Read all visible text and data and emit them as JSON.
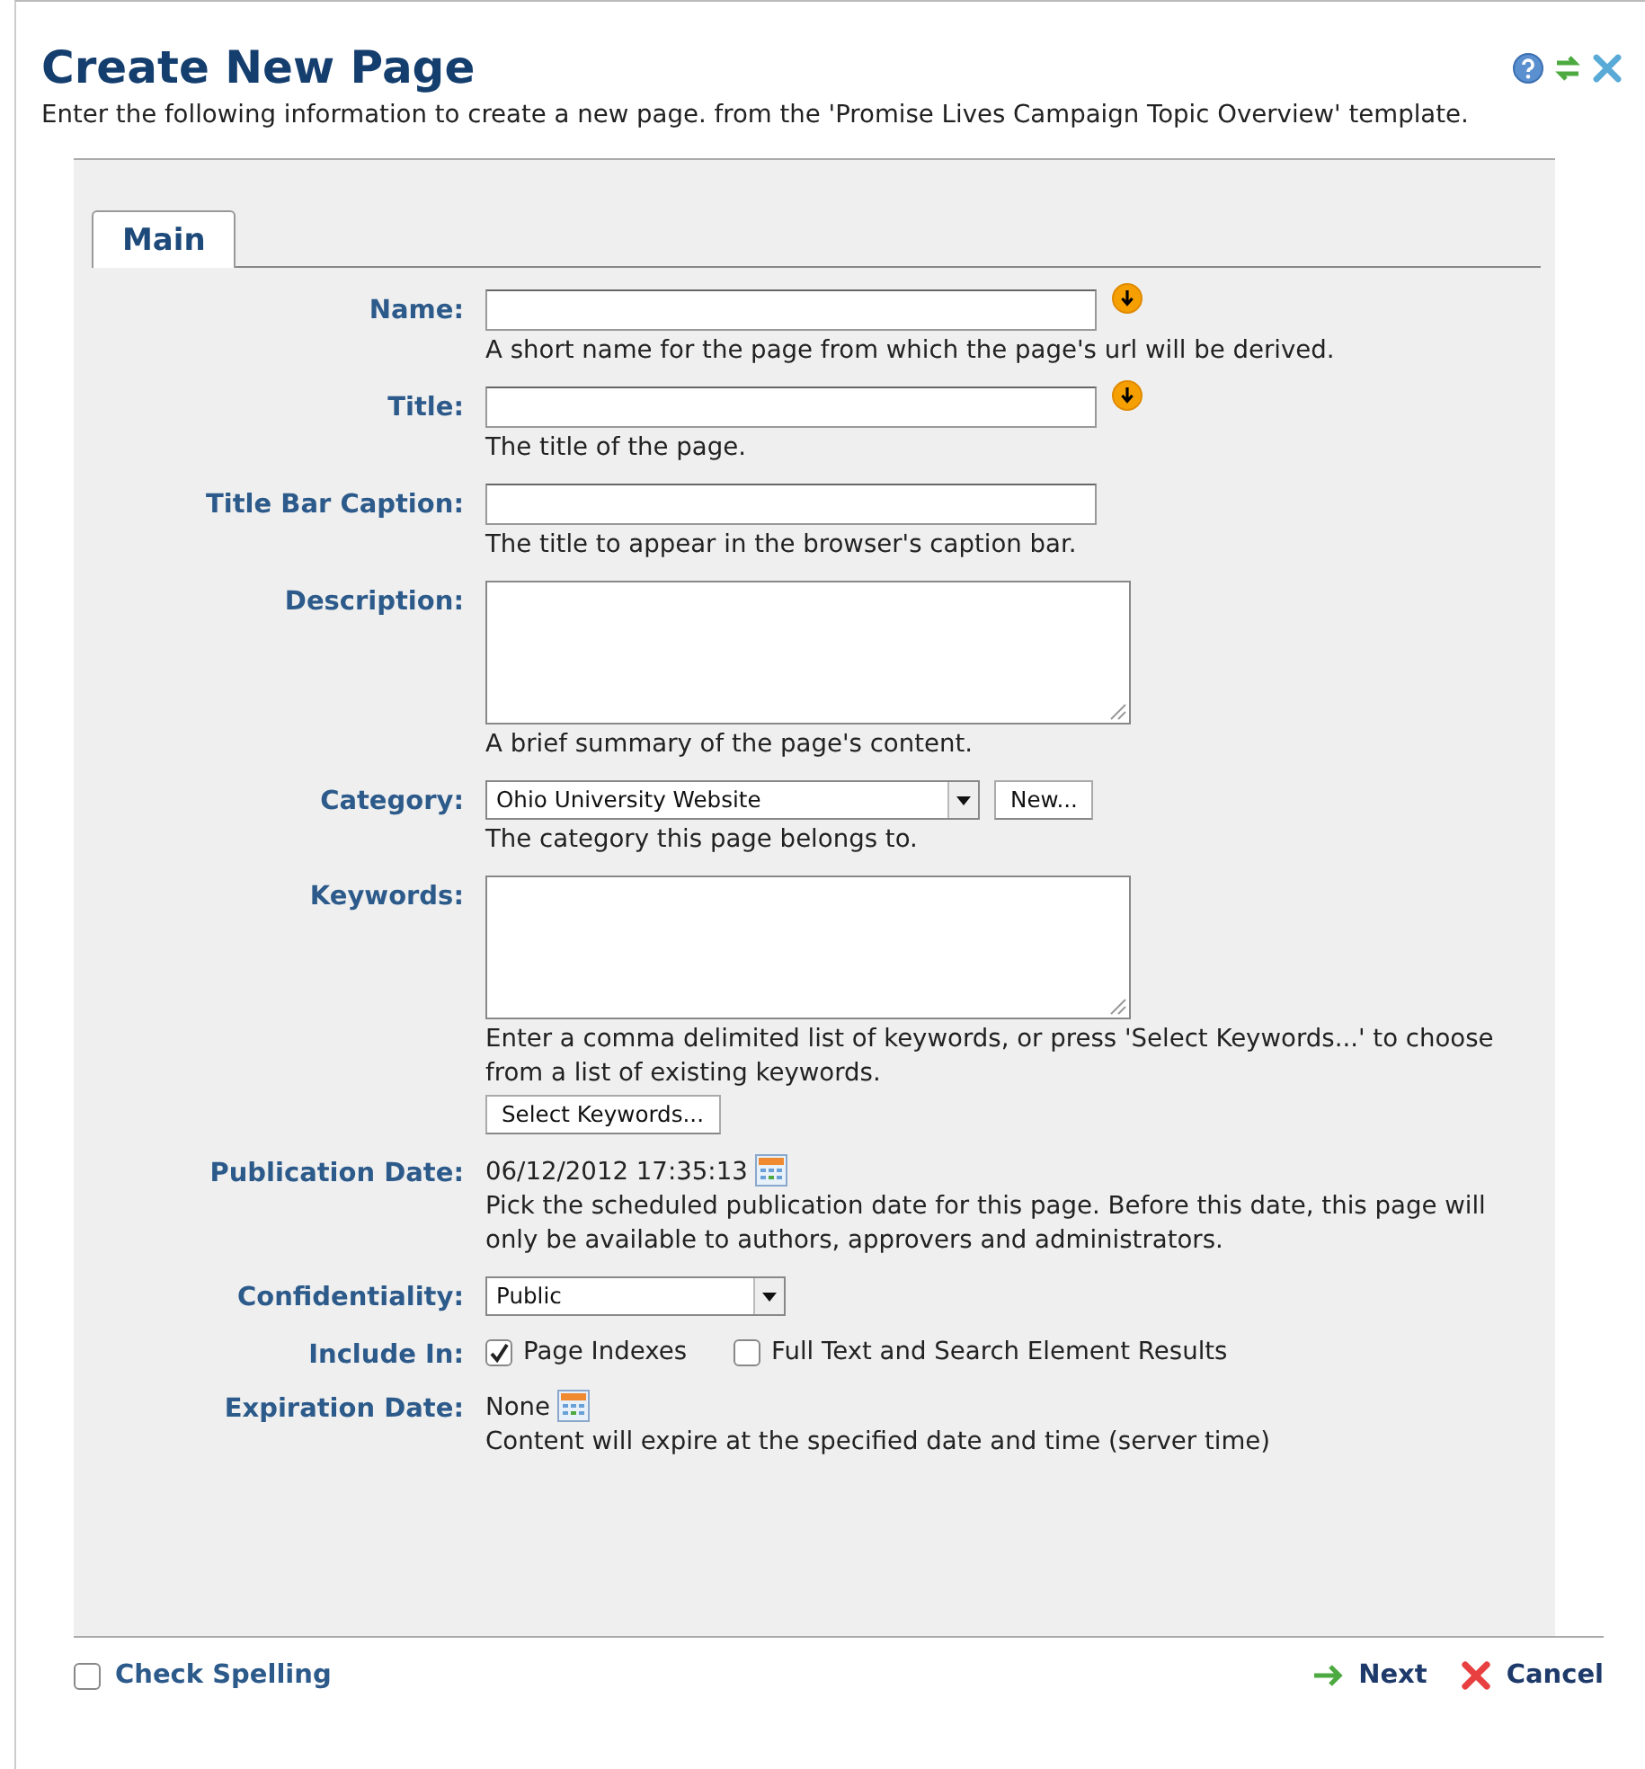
{
  "dialog": {
    "title": "Create New Page",
    "intro": "Enter the following information to create a new page. from the 'Promise Lives Campaign Topic Overview' template."
  },
  "tabs": [
    {
      "label": "Main",
      "selected": true
    }
  ],
  "fields": [
    {
      "kind": "text",
      "label": "Name:",
      "required": true,
      "hint": "A short name for the page from which the page's url will be derived."
    },
    {
      "kind": "text",
      "label": "Title:",
      "required": true,
      "hint": "The title of the page."
    },
    {
      "kind": "text",
      "label": "Title Bar Caption:",
      "required": false,
      "hint": "The title to appear in the browser's caption bar."
    },
    {
      "kind": "textarea",
      "label": "Description:",
      "hint": "A brief summary of the page's content."
    },
    {
      "kind": "select",
      "label": "Category:",
      "value": "Ohio University Website",
      "button": "New...",
      "hint": "The category this page belongs to."
    },
    {
      "kind": "textarea",
      "label": "Keywords:",
      "hint": "Enter a comma delimited list of keywords, or press 'Select Keywords...' to choose from a list of existing keywords.",
      "button": "Select Keywords..."
    },
    {
      "kind": "date",
      "label": "Publication Date:",
      "value": "06/12/2012 17:35:13",
      "hint": "Pick the scheduled publication date for this page. Before this date, this page will only be available to authors, approvers and administrators."
    },
    {
      "kind": "select",
      "label": "Confidentiality:",
      "value": "Public"
    },
    {
      "kind": "checkboxes",
      "label": "Include In:",
      "options": [
        {
          "label": "Page Indexes",
          "checked": true
        },
        {
          "label": "Full Text and Search Element Results",
          "checked": false
        }
      ]
    },
    {
      "kind": "date",
      "label": "Expiration Date:",
      "value": "None",
      "hint": "Content will expire at the specified date and time (server time)"
    }
  ],
  "footer": {
    "check_spelling": {
      "label": "Check Spelling",
      "checked": false
    },
    "actions": [
      {
        "kind": "next",
        "label": "Next"
      },
      {
        "kind": "cancel",
        "label": "Cancel"
      }
    ]
  }
}
